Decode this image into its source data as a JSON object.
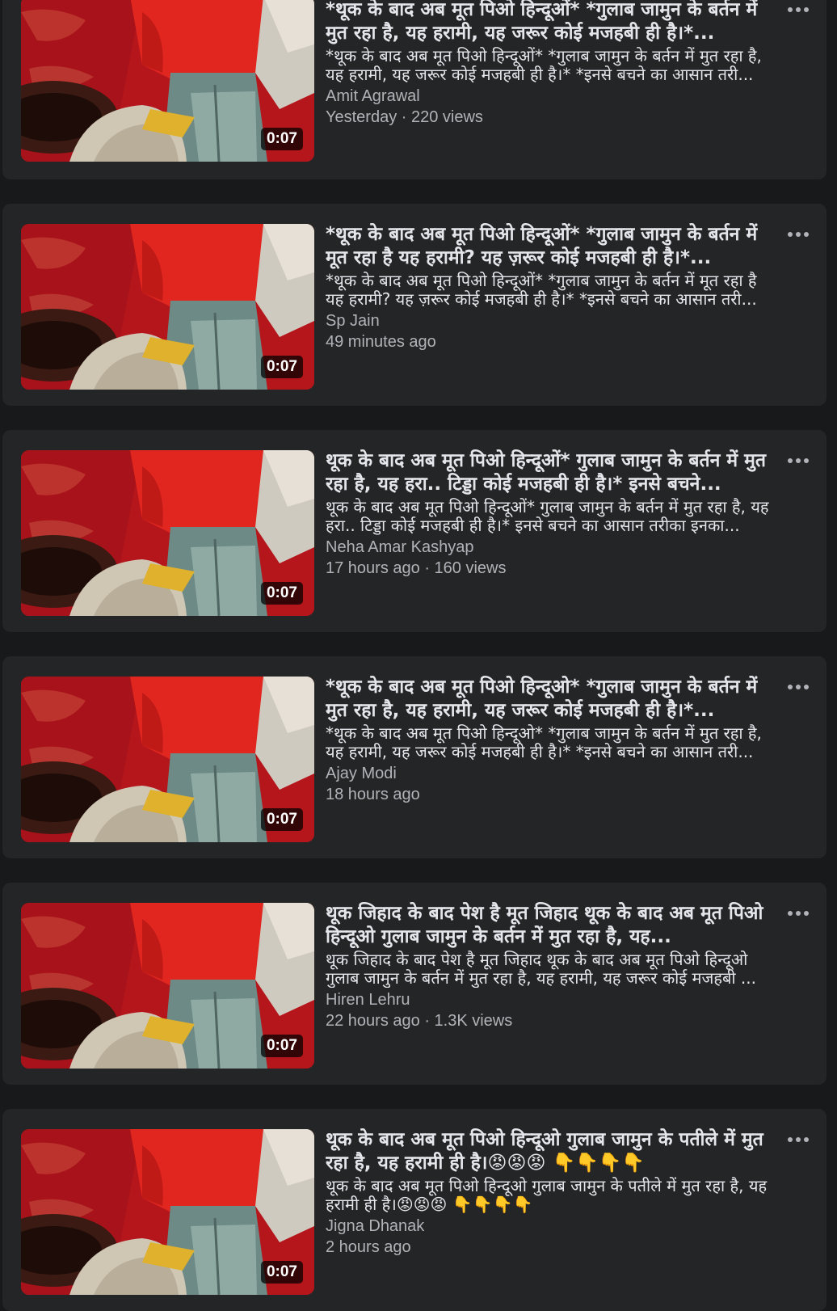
{
  "feed": {
    "items": [
      {
        "title": "*थूक के बाद अब मूत पिओ हिन्दूओं* *गुलाब जामुन के बर्तन में मुत रहा है, यह हरामी, यह जरूर कोई मजहबी ही है।*...",
        "description": "*थूक के बाद अब मूत पिओ हिन्दूओं* *गुलाब जामुन के बर्तन में मुत रहा है, यह हरामी, यह जरूर कोई मजहबी ही है।* *इनसे बचने का आसान तरी...",
        "author": "Amit Agrawal",
        "meta": "Yesterday · 220 views",
        "duration": "0:07"
      },
      {
        "title": "*थूक के बाद अब मूत पिओ हिन्दूओं* *गुलाब जामुन के बर्तन में मूत रहा है यह हरामी? यह ज़रूर कोई मजहबी ही है।*...",
        "description": "*थूक के बाद अब मूत पिओ हिन्दूओं* *गुलाब जामुन के बर्तन में मूत रहा है यह हरामी? यह ज़रूर कोई मजहबी ही है।* *इनसे बचने का आसान तरी...",
        "author": "Sp Jain",
        "meta": "49 minutes ago",
        "duration": "0:07"
      },
      {
        "title": "थूक के बाद अब मूत पिओ हिन्दूओं* गुलाब जामुन के बर्तन में मुत रहा है, यह हरा.. टिड्डा कोई मजहबी ही है।* इनसे बचने...",
        "description": "थूक के बाद अब मूत पिओ हिन्दूओं* गुलाब जामुन के बर्तन में मुत रहा है, यह हरा.. टिड्डा कोई मजहबी ही है।* इनसे बचने का आसान तरीका इनका...",
        "author": "Neha Amar Kashyap",
        "meta": "17 hours ago · 160 views",
        "duration": "0:07"
      },
      {
        "title": "*थूक के बाद अब मूत पिओ हिन्दूओ* *गुलाब जामुन के बर्तन में मुत रहा है, यह हरामी, यह जरूर कोई मजहबी ही है।*...",
        "description": "*थूक के बाद अब मूत पिओ हिन्दूओ* *गुलाब जामुन के बर्तन में मुत रहा है, यह हरामी, यह जरूर कोई मजहबी ही है।* *इनसे बचने का आसान तरी...",
        "author": "Ajay Modi",
        "meta": "18 hours ago",
        "duration": "0:07"
      },
      {
        "title": "थूक जिहाद के बाद पेश है मूत जिहाद थूक के बाद अब मूत पिओ हिन्दूओ गुलाब जामुन के बर्तन में मुत रहा है, यह...",
        "description": "थूक जिहाद के बाद पेश है मूत जिहाद थूक के बाद अब मूत पिओ हिन्दूओ गुलाब जामुन के बर्तन में मुत रहा है, यह हरामी, यह जरूर कोई मजहबी ...",
        "author": "Hiren Lehru",
        "meta": "22 hours ago · 1.3K views",
        "duration": "0:07"
      },
      {
        "title": "थूक के बाद अब मूत पिओ हिन्दूओ गुलाब जामुन के पतीले में मुत रहा है, यह हरामी ही है।😡😡😡 👇👇👇👇",
        "description": "थूक के बाद अब मूत पिओ हिन्दूओ गुलाब जामुन के पतीले में मुत रहा है, यह हरामी ही है।😡😡😡 👇👇👇👇",
        "author": "Jigna Dhanak",
        "meta": "2 hours ago",
        "duration": "0:07"
      }
    ]
  },
  "icons": {
    "more": "more-options-icon"
  },
  "colors": {
    "page_background": "#18191a",
    "card_background": "#242526",
    "primary_text": "#e4e6eb",
    "secondary_text": "#b0b3b8"
  }
}
